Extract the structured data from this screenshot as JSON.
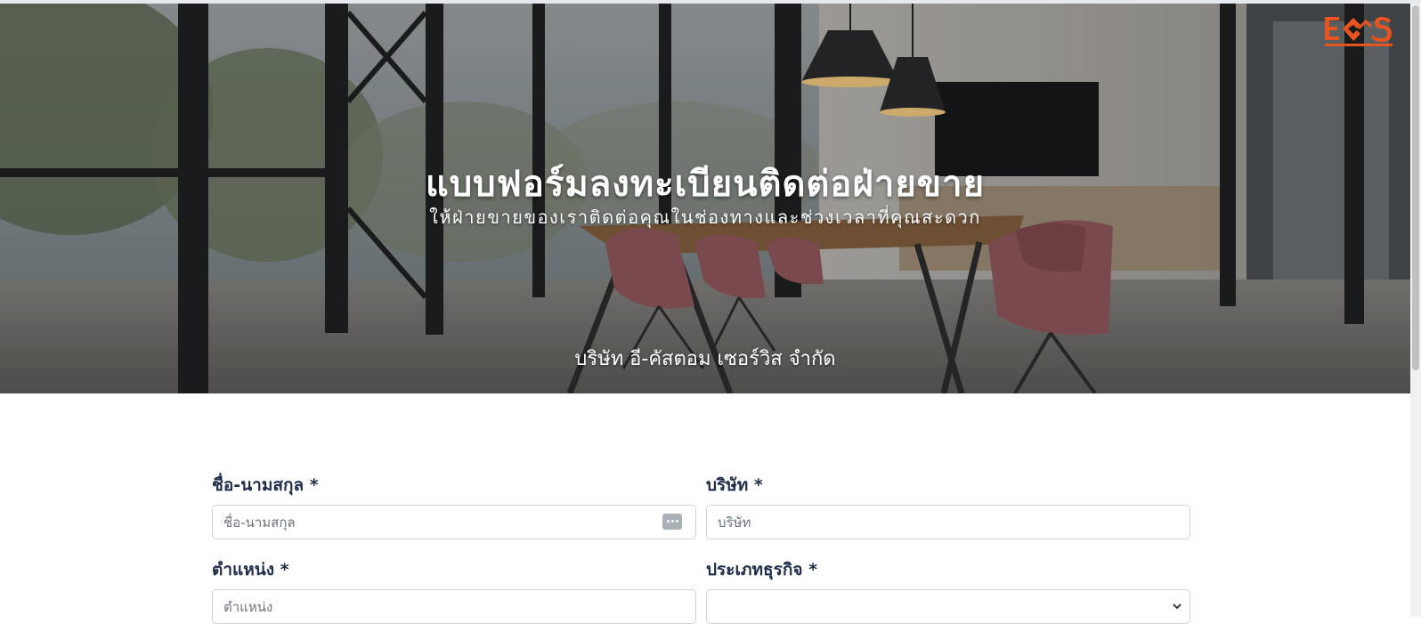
{
  "hero": {
    "title": "แบบฟอร์มลงทะเบียนติดต่อฝ่ายขาย",
    "subtitle": "ให้ฝ่ายขายของเราติดต่อคุณในช่องทางและช่วงเวลาที่คุณสะดวก",
    "company": "บริษัท อี-คัสตอม เซอร์วิส จำกัด"
  },
  "logo": {
    "text": "ECS",
    "color": "#e8531f"
  },
  "form": {
    "name": {
      "label": "ชื่อ-นามสกุล *",
      "placeholder": "ชื่อ-นามสกุล",
      "value": ""
    },
    "company": {
      "label": "บริษัท *",
      "placeholder": "บริษัท",
      "value": ""
    },
    "position": {
      "label": "ตำแหน่ง *",
      "placeholder": "ตำแหน่ง",
      "value": ""
    },
    "business_type": {
      "label": "ประเภทธุรกิจ *",
      "selected": ""
    }
  },
  "colors": {
    "label": "#1f2d4a",
    "accent": "#e8531f",
    "input_border": "#ced4da"
  }
}
